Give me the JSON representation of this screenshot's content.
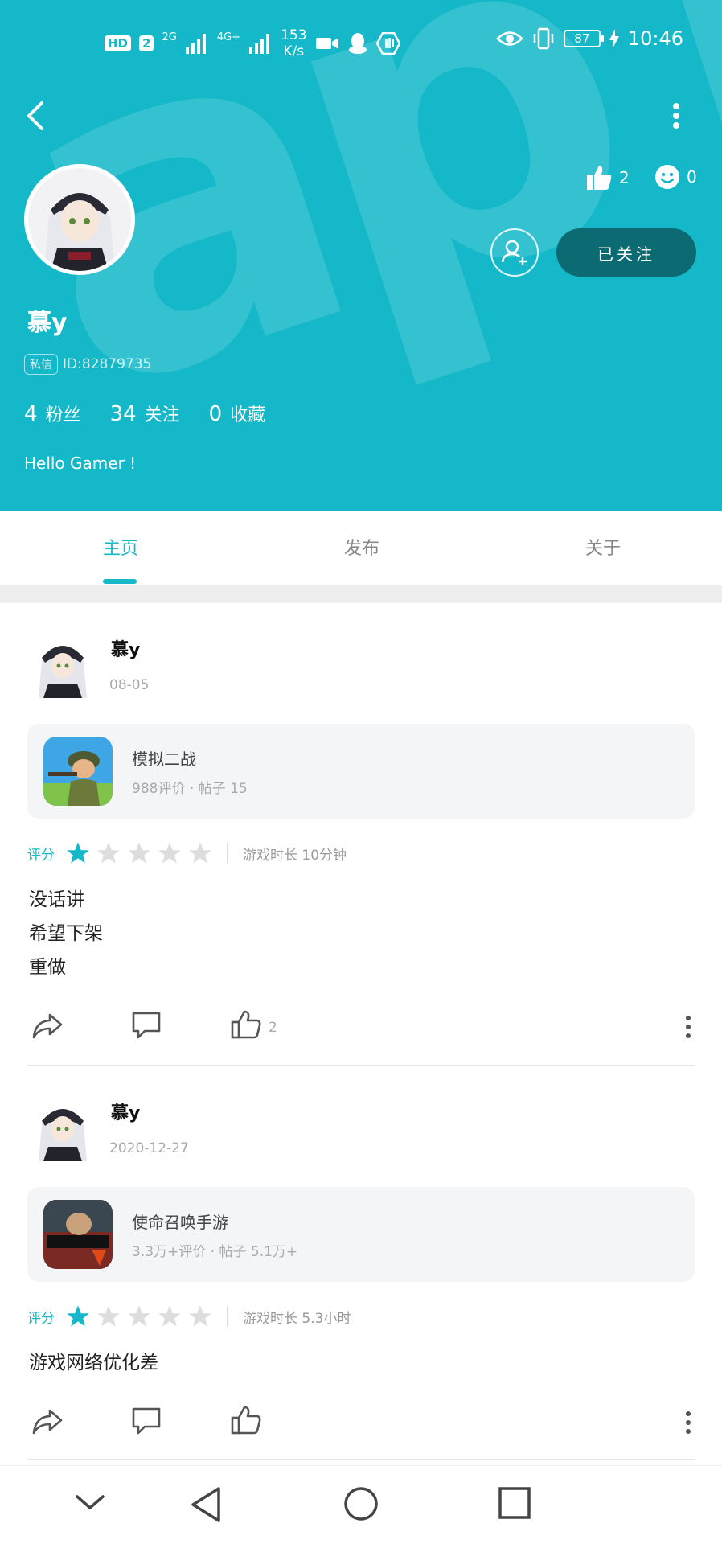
{
  "status_bar": {
    "hd": "HD",
    "hd_slot": "2",
    "net1": "2G",
    "net2": "4G+",
    "speed_value": "153",
    "speed_unit": "K/s",
    "battery": "87",
    "time": "10:46"
  },
  "profile": {
    "name": "慕y",
    "tag": "私信",
    "id_text": "ID:82879735",
    "like_count": "2",
    "emoji_count": "0",
    "follow_button": "已关注",
    "followers_num": "4",
    "followers_label": "粉丝",
    "following_num": "34",
    "following_label": "关注",
    "favorites_num": "0",
    "favorites_label": "收藏",
    "bio": "Hello Gamer !"
  },
  "tabs": [
    {
      "label": "主页",
      "active": true
    },
    {
      "label": "发布",
      "active": false
    },
    {
      "label": "关于",
      "active": false
    }
  ],
  "posts": [
    {
      "author": "慕y",
      "date": "08-05",
      "game_title": "模拟二战",
      "game_meta": "988评价 · 帖子 15",
      "rating_label": "评分",
      "rating": 1,
      "playtime": "游戏时长 10分钟",
      "text_lines": [
        "没话讲",
        "希望下架",
        "重做"
      ],
      "likes": "2"
    },
    {
      "author": "慕y",
      "date": "2020-12-27",
      "game_title": "使命召唤手游",
      "game_meta": "3.3万+评价 · 帖子 5.1万+",
      "rating_label": "评分",
      "rating": 1,
      "playtime": "游戏时长 5.3小时",
      "text_lines": [
        "游戏网络优化差"
      ],
      "likes": ""
    }
  ],
  "colors": {
    "accent": "#14b8c9",
    "follow_button": "#0c6a73",
    "star_empty": "#dddddd"
  }
}
